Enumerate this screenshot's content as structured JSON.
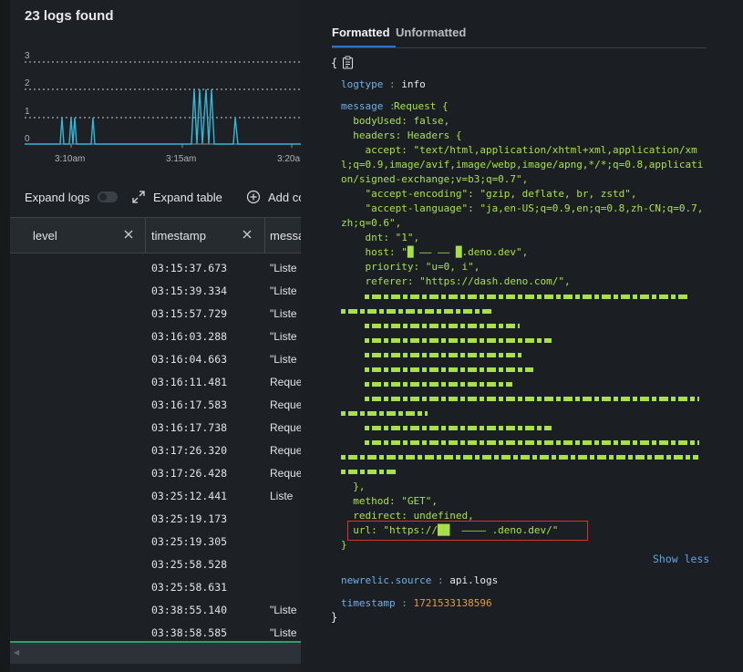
{
  "logs_count": "23 logs found",
  "chart": {
    "y_ticks": [
      "3",
      "2",
      "1",
      "0"
    ],
    "x_ticks": [
      "3:10am",
      "3:15am",
      "3:20a"
    ],
    "line_color": "#38b4d6"
  },
  "toolbar": {
    "expand_logs": "Expand logs",
    "expand_table": "Expand table",
    "add_column": "Add co"
  },
  "table": {
    "columns": [
      "level",
      "timestamp",
      "messa"
    ],
    "rows": [
      {
        "ts": "03:15:37.673",
        "msg": "\"Liste"
      },
      {
        "ts": "03:15:39.334",
        "msg": "\"Liste"
      },
      {
        "ts": "03:15:57.729",
        "msg": "\"Liste"
      },
      {
        "ts": "03:16:03.288",
        "msg": "\"Liste"
      },
      {
        "ts": "03:16:04.663",
        "msg": "\"Liste"
      },
      {
        "ts": "03:16:11.481",
        "msg": "Reque"
      },
      {
        "ts": "03:16:17.583",
        "msg": "Reque"
      },
      {
        "ts": "03:16:17.738",
        "msg": "Reque"
      },
      {
        "ts": "03:17:26.320",
        "msg": "Reque"
      },
      {
        "ts": "03:17:26.428",
        "msg": "Reque"
      },
      {
        "ts": "03:25:12.441",
        "msg": "Liste"
      },
      {
        "ts": "03:25:19.173",
        "msg": ""
      },
      {
        "ts": "03:25:19.305",
        "msg": ""
      },
      {
        "ts": "03:25:58.528",
        "msg": ""
      },
      {
        "ts": "03:25:58.631",
        "msg": ""
      },
      {
        "ts": "03:38:55.140",
        "msg": "\"Liste"
      },
      {
        "ts": "03:38:58.585",
        "msg": "\"Liste"
      }
    ]
  },
  "detail": {
    "tabs": [
      "Formatted",
      "Unformatted"
    ],
    "open_brace": "{",
    "close_brace": "}",
    "logtype_key": "logtype",
    "logtype_val": "info",
    "message_key": "message",
    "colon": ":",
    "message_lines": [
      "Request {",
      "  bodyUsed: false,",
      "  headers: Headers {",
      "    accept: \"text/html,application/xhtml+xml,application/xm",
      "l;q=0.9,image/avif,image/webp,image/apng,*/*;q=0.8,applicati",
      "on/signed-exchange;v=b3;q=0.7\",",
      "    \"accept-encoding\": \"gzip, deflate, br, zstd\",",
      "    \"accept-language\": \"ja,en-US;q=0.9,en;q=0.8,zh-CN;q=0.7,",
      "zh;q=0.6\",",
      "    dnt: \"1\",",
      "    host: \"█ —— —— █.deno.dev\",",
      "    priority: \"u=0, i\",",
      "    referer: \"https://dash.deno.com/\","
    ],
    "message_tail": [
      "  },",
      "  method: \"GET\",",
      "  redirect: undefined,"
    ],
    "url_line": "  url: \"https://██  ———— .deno.dev/\"",
    "message_close": "}",
    "show_less": "Show less",
    "source_key": "newrelic.source",
    "source_val": "api.logs",
    "timestamp_key": "timestamp",
    "timestamp_val": "1721533138596",
    "accent_link": "#5fa3e6",
    "code_green": "#a8e04a",
    "highlight_border": "#d9342b"
  }
}
